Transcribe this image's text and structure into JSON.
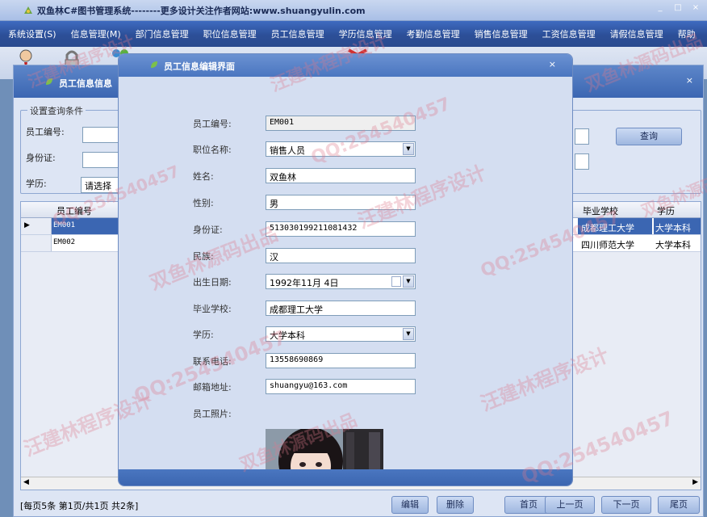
{
  "app": {
    "title": "双鱼林C#图书管理系统--------更多设计关注作者网站:www.shuangyulin.com"
  },
  "menu": [
    "系统设置(S)",
    "信息管理(M)",
    "部门信息管理",
    "职位信息管理",
    "员工信息管理",
    "学历信息管理",
    "考勤信息管理",
    "销售信息管理",
    "工资信息管理",
    "请假信息管理",
    "帮助"
  ],
  "info_window": {
    "title": "员工信息信息",
    "close_glyph": "×",
    "query": {
      "legend": "设置查询条件",
      "emp_no_label": "员工编号:",
      "id_card_label": "身份证:",
      "education_label": "学历:",
      "education_value": "请选择",
      "query_button": "查询"
    },
    "grid": {
      "headers": {
        "emp_no": "员工编号",
        "school": "毕业学校",
        "education": "学历"
      },
      "rows": [
        {
          "marker": "▶",
          "emp_no": "EM001",
          "school": "成都理工大学",
          "education": "大学本科"
        },
        {
          "marker": "",
          "emp_no": "EM002",
          "school": "四川师范大学",
          "education": "大学本科"
        }
      ]
    },
    "status": {
      "page_info": "[每页5条  第1页/共1页    共2条]",
      "edit": "编辑",
      "delete": "删除",
      "first": "首页",
      "prev": "上一页",
      "next": "下一页",
      "last": "尾页"
    }
  },
  "edit_dialog": {
    "title": "员工信息编辑界面",
    "close_glyph": "×",
    "fields": {
      "emp_no": {
        "label": "员工编号:",
        "value": "EM001"
      },
      "position": {
        "label": "职位名称:",
        "value": "销售人员"
      },
      "name": {
        "label": "姓名:",
        "value": "双鱼林"
      },
      "gender": {
        "label": "性别:",
        "value": "男"
      },
      "id_card": {
        "label": "身份证:",
        "value": "513030199211081432"
      },
      "nation": {
        "label": "民族:",
        "value": "汉"
      },
      "birth": {
        "label": "出生日期:",
        "value": "1992年11月 4日"
      },
      "school": {
        "label": "毕业学校:",
        "value": "成都理工大学"
      },
      "education": {
        "label": "学历:",
        "value": "大学本科"
      },
      "phone": {
        "label": "联系电话:",
        "value": "13558690869"
      },
      "email": {
        "label": "邮箱地址:",
        "value": "shuangyu@163.com"
      },
      "photo": {
        "label": "员工照片:"
      }
    }
  },
  "watermarks": [
    "QQ:254540457",
    "汪建林程序设计",
    "双鱼林源码出品",
    "QQ:254540457",
    "汪建林程序设计",
    "双鱼林源码出品",
    "QQ:254540457",
    "汪建林程序设计",
    "双鱼林源码出品",
    "QQ:254540457",
    "汪建林程序设计",
    "QQ:254540457",
    "双鱼林源码出品",
    "汪建林程序设计"
  ],
  "colors": {
    "menubar": "#2c4f98",
    "window_title": "#4a76c0",
    "watermark": "#dc788c"
  }
}
